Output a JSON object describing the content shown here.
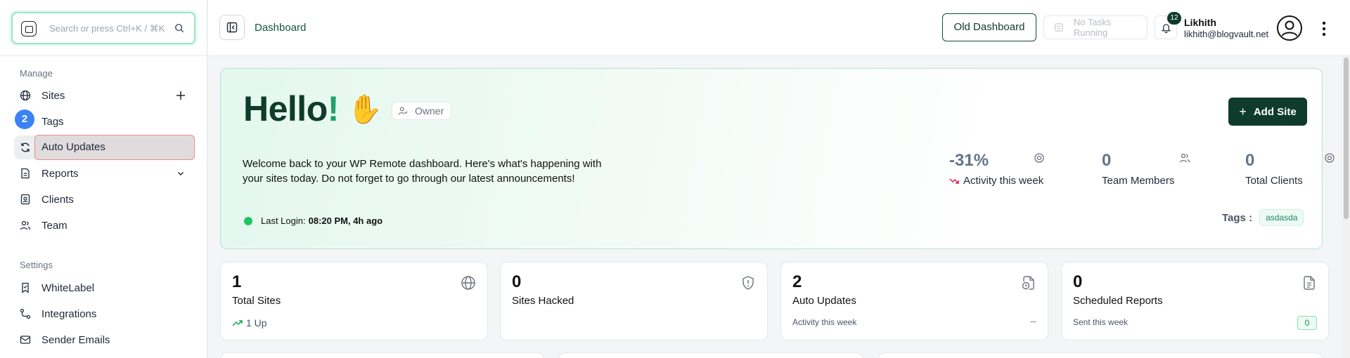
{
  "search": {
    "placeholder": "Search or press Ctrl+K / ⌘K"
  },
  "sidebar": {
    "manage_label": "Manage",
    "settings_label": "Settings",
    "badge": "2",
    "items": [
      {
        "label": "Sites",
        "icon": "globe-icon"
      },
      {
        "label": "Tags",
        "icon": "tag-icon"
      },
      {
        "label": "Auto Updates",
        "icon": "refresh-icon"
      },
      {
        "label": "Reports",
        "icon": "document-icon"
      },
      {
        "label": "Clients",
        "icon": "contact-icon"
      },
      {
        "label": "Team",
        "icon": "team-icon"
      }
    ],
    "settings_items": [
      {
        "label": "WhiteLabel",
        "icon": "bookmark-icon"
      },
      {
        "label": "Integrations",
        "icon": "integrations-icon"
      },
      {
        "label": "Sender Emails",
        "icon": "mail-icon"
      }
    ]
  },
  "header": {
    "breadcrumb": "Dashboard",
    "old_dashboard": "Old Dashboard",
    "tasks": "No Tasks Running",
    "notifications": "12",
    "user_name": "Likhith",
    "user_email": "likhith@blogvault.net"
  },
  "hero": {
    "hello": "Hello",
    "exclaim": "!",
    "wave": "✋",
    "role": "Owner",
    "welcome": "Welcome back to your WP Remote dashboard. Here's what's happening with your sites today. Do not forget to go through our latest announcements!",
    "last_login_label": "Last Login:",
    "last_login_value": "08:20 PM, 4h ago",
    "add_site": "Add Site",
    "tags_label": "Tags :",
    "tag": "asdasda",
    "stats": [
      {
        "value": "-31%",
        "label": "Activity this week"
      },
      {
        "value": "0",
        "label": "Team Members"
      },
      {
        "value": "0",
        "label": "Total Clients"
      }
    ]
  },
  "cards": [
    {
      "value": "1",
      "title": "Total Sites",
      "sub": "1 Up",
      "icon": "globe-icon"
    },
    {
      "value": "0",
      "title": "Sites Hacked",
      "sub": "",
      "icon": "shield-icon"
    },
    {
      "value": "2",
      "title": "Auto Updates",
      "sub": "Activity this week",
      "right": "--",
      "icon": "file-clock-icon"
    },
    {
      "value": "0",
      "title": "Scheduled Reports",
      "sub": "Sent this week",
      "right": "0",
      "icon": "file-text-icon"
    }
  ],
  "colors": {
    "brand": "#0f3b2c",
    "accent": "#22a06b",
    "badge": "#3b82f6"
  }
}
